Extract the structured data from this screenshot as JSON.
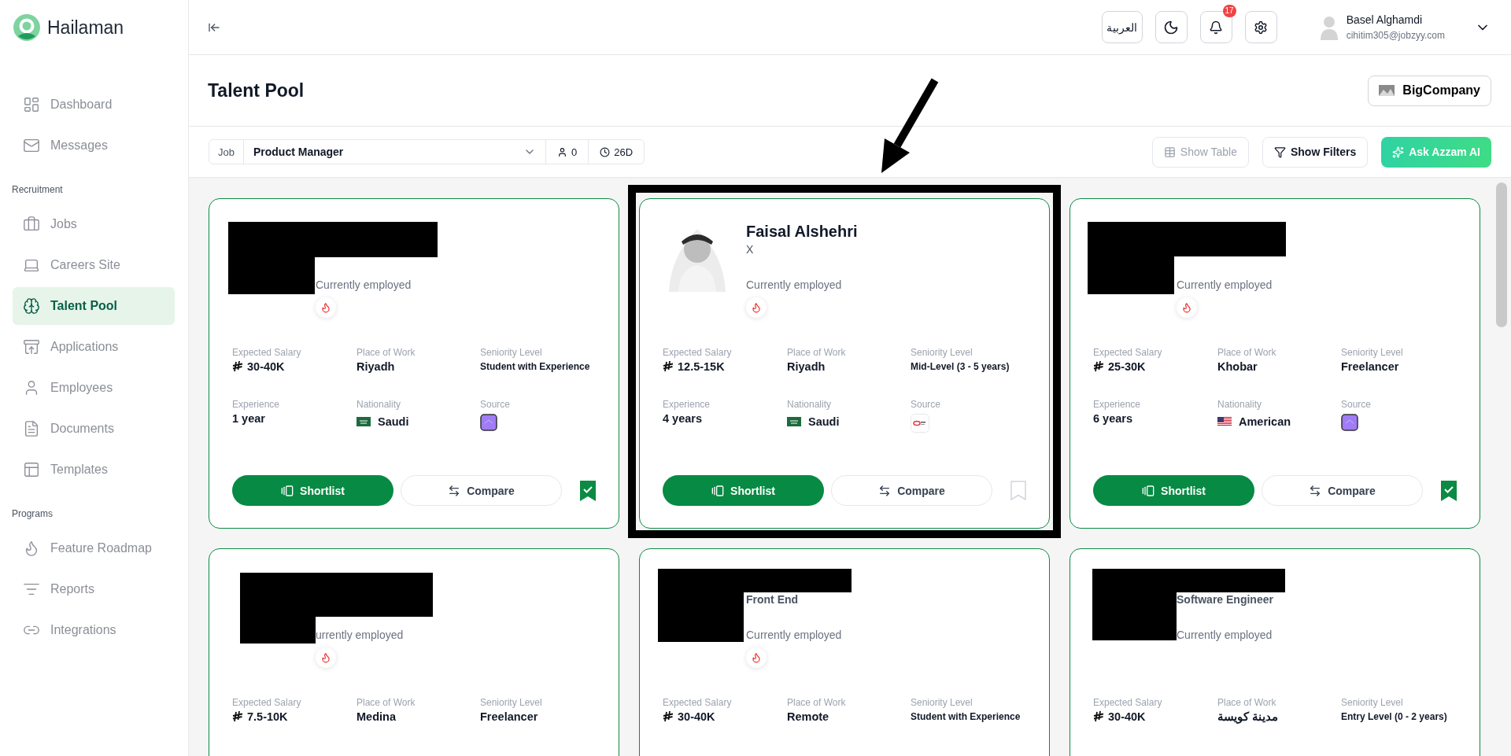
{
  "app": {
    "name": "Hailaman"
  },
  "sidebar": {
    "sections": [
      {
        "items": [
          {
            "label": "Dashboard",
            "selected": false
          },
          {
            "label": "Messages",
            "selected": false
          }
        ]
      },
      {
        "title": "Recruitment",
        "items": [
          {
            "label": "Jobs",
            "selected": false
          },
          {
            "label": "Careers Site",
            "selected": false
          },
          {
            "label": "Talent Pool",
            "selected": true
          },
          {
            "label": "Applications",
            "selected": false
          },
          {
            "label": "Employees",
            "selected": false
          },
          {
            "label": "Documents",
            "selected": false
          },
          {
            "label": "Templates",
            "selected": false
          }
        ]
      },
      {
        "title": "Programs",
        "items": [
          {
            "label": "Feature Roadmap",
            "selected": false
          },
          {
            "label": "Reports",
            "selected": false
          },
          {
            "label": "Integrations",
            "selected": false
          }
        ]
      }
    ]
  },
  "topbar": {
    "language": "العربية",
    "notifications": "17",
    "user": {
      "name": "Basel Alghamdi",
      "email": "cihitim305@jobzyy.com"
    }
  },
  "header": {
    "title": "Talent Pool",
    "company": "BigCompany"
  },
  "toolbar": {
    "job_label": "Job",
    "job": "Product Manager",
    "applicants": "0",
    "age": "26D",
    "buttons": [
      {
        "label": "Show Table",
        "kind": "table",
        "disabled": true
      },
      {
        "label": "Show Filters",
        "kind": "filter",
        "disabled": false
      },
      {
        "label": "Ask Azzam AI",
        "kind": "ai",
        "disabled": false
      }
    ]
  },
  "cards": [
    {
      "redacted": true,
      "status": "Currently employed",
      "hot": true,
      "saved": true,
      "actions": {
        "shortlist": "Shortlist",
        "compare": "Compare"
      },
      "fields": [
        {
          "label": "Expected Salary",
          "value": "30-40K",
          "kind": "salary"
        },
        {
          "label": "Place of Work",
          "value": "Riyadh",
          "kind": "text"
        },
        {
          "label": "Seniority Level",
          "value": "Student with Experience",
          "kind": "text"
        },
        {
          "label": "Experience",
          "value": "1 year",
          "kind": "text"
        },
        {
          "label": "Nationality",
          "value": "Saudi",
          "kind": "nationality",
          "flag": {
            "kind": "saudi"
          }
        },
        {
          "label": "Source",
          "kind": "source",
          "source": {
            "kind": "app"
          }
        }
      ]
    },
    {
      "redacted": false,
      "name": "Faisal Alshehri",
      "title": "X",
      "status": "Currently employed",
      "hot": true,
      "saved": false,
      "actions": {
        "shortlist": "Shortlist",
        "compare": "Compare"
      },
      "fields": [
        {
          "label": "Expected Salary",
          "value": "12.5-15K",
          "kind": "salary"
        },
        {
          "label": "Place of Work",
          "value": "Riyadh",
          "kind": "text"
        },
        {
          "label": "Seniority Level",
          "value": "Mid-Level (3 - 5 years)",
          "kind": "text"
        },
        {
          "label": "Experience",
          "value": "4 years",
          "kind": "text"
        },
        {
          "label": "Nationality",
          "value": "Saudi",
          "kind": "nationality",
          "flag": {
            "kind": "saudi"
          }
        },
        {
          "label": "Source",
          "kind": "source",
          "source": {
            "kind": "brand"
          }
        }
      ]
    },
    {
      "redacted": true,
      "status": "Currently employed",
      "hot": true,
      "saved": true,
      "actions": {
        "shortlist": "Shortlist",
        "compare": "Compare"
      },
      "fields": [
        {
          "label": "Expected Salary",
          "value": "25-30K",
          "kind": "salary"
        },
        {
          "label": "Place of Work",
          "value": "Khobar",
          "kind": "text"
        },
        {
          "label": "Seniority Level",
          "value": "Freelancer",
          "kind": "text"
        },
        {
          "label": "Experience",
          "value": "6 years",
          "kind": "text"
        },
        {
          "label": "Nationality",
          "value": "American",
          "kind": "nationality",
          "flag": {
            "kind": "american"
          }
        },
        {
          "label": "Source",
          "kind": "source",
          "source": {
            "kind": "app"
          }
        }
      ]
    },
    {
      "redacted": true,
      "status": "urrently employed",
      "hot": true,
      "fields": [
        {
          "label": "Expected Salary",
          "value": "7.5-10K",
          "kind": "salary"
        },
        {
          "label": "Place of Work",
          "value": "Medina",
          "kind": "text"
        },
        {
          "label": "Seniority Level",
          "value": "Freelancer",
          "kind": "text"
        }
      ]
    },
    {
      "redacted": true,
      "title": "Front End",
      "status": "Currently employed",
      "hot": true,
      "fields": [
        {
          "label": "Expected Salary",
          "value": "30-40K",
          "kind": "salary"
        },
        {
          "label": "Place of Work",
          "value": "Remote",
          "kind": "text"
        },
        {
          "label": "Seniority Level",
          "value": "Student with Experience",
          "kind": "text"
        }
      ]
    },
    {
      "redacted": true,
      "title": "Software Engineer",
      "status": "Currently employed",
      "hot": false,
      "fields": [
        {
          "label": "Expected Salary",
          "value": "30-40K",
          "kind": "salary"
        },
        {
          "label": "Place of Work",
          "value": "مدينة كويسة",
          "kind": "text"
        },
        {
          "label": "Seniority Level",
          "value": "Entry Level (0 - 2 years)",
          "kind": "text"
        }
      ]
    }
  ],
  "annotation": {
    "frame": true,
    "arrow": true
  }
}
